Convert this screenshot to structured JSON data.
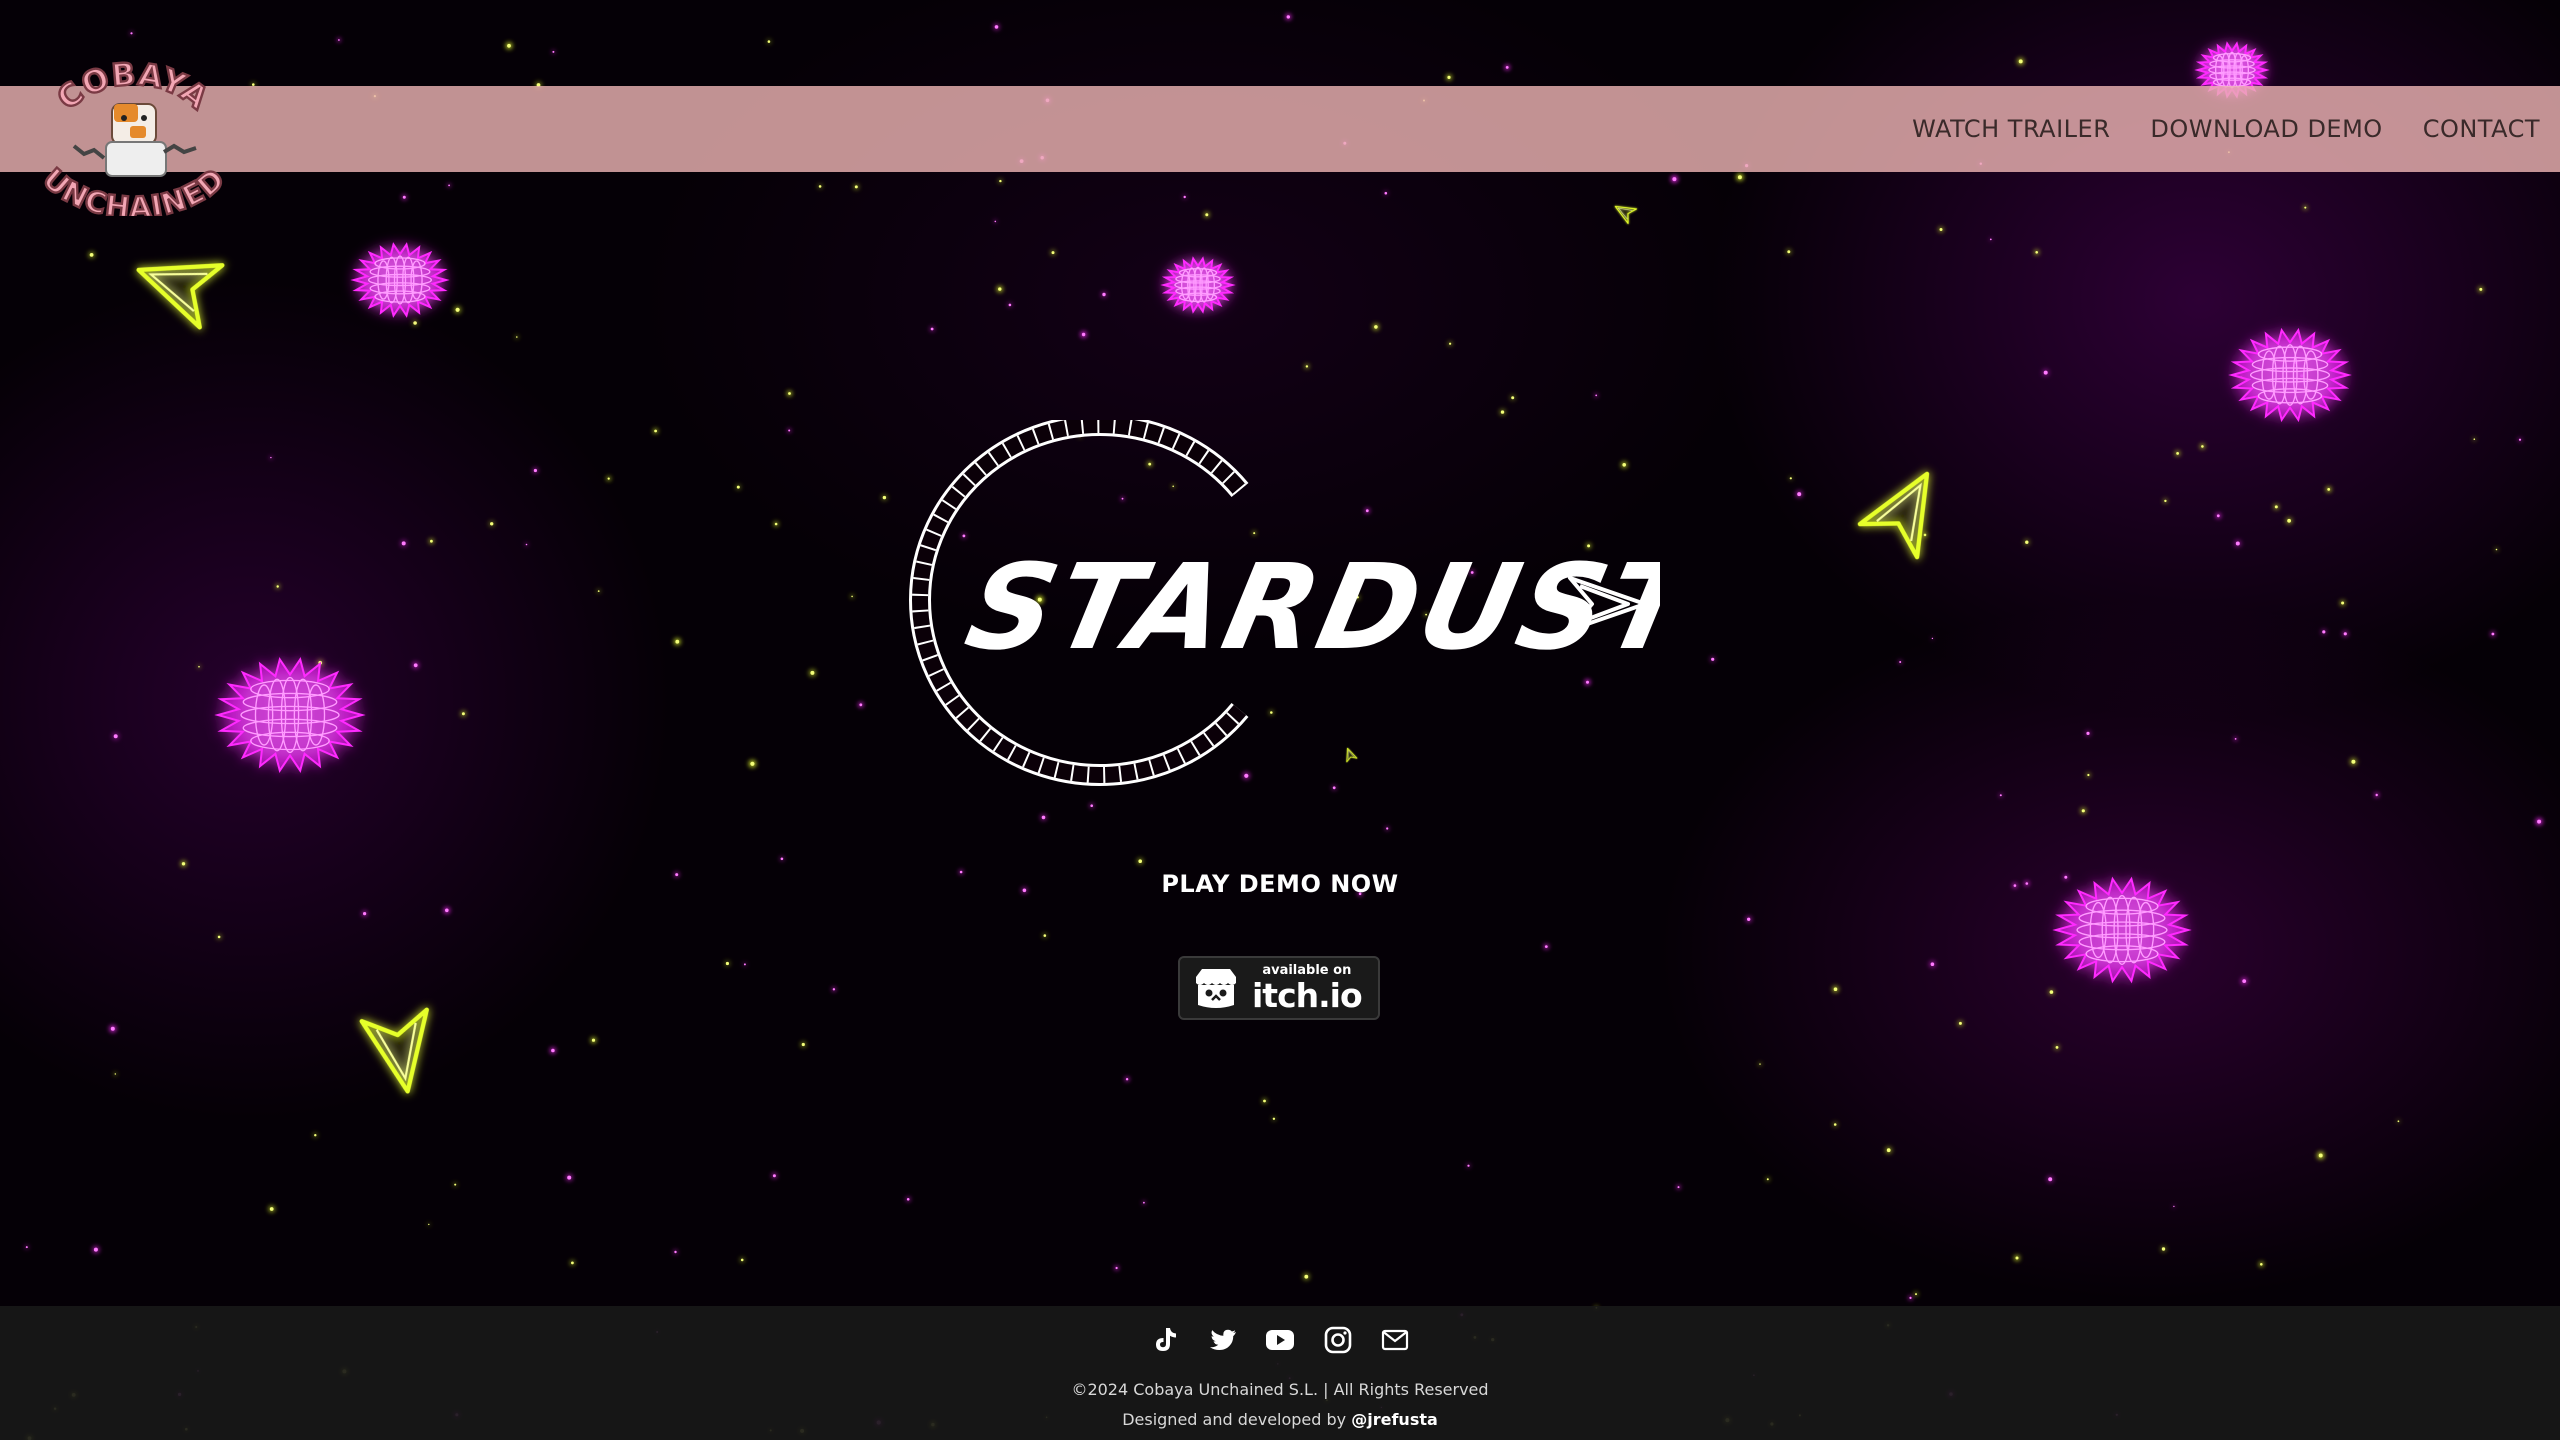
{
  "brand": {
    "logo_text_top": "COBAYA",
    "logo_text_bottom": "UNCHAINED",
    "logo_icon": "guinea-pig-mascot"
  },
  "nav": {
    "items": [
      {
        "label": "WATCH TRAILER"
      },
      {
        "label": "DOWNLOAD DEMO"
      },
      {
        "label": "CONTACT"
      }
    ]
  },
  "hero": {
    "game_title": "STARDUSTER",
    "cta_label": "PLAY DEMO NOW",
    "badge": {
      "small_text": "available on",
      "big_text": "itch.io",
      "icon": "itch-io-icon"
    }
  },
  "footer": {
    "social_icons": [
      "tiktok-icon",
      "twitter-icon",
      "youtube-icon",
      "instagram-icon",
      "mail-icon"
    ],
    "copyright": "©2024 Cobaya Unchained S.L. | All Rights Reserved",
    "credits_prefix": "Designed and developed by",
    "credits_handle": "@jrefusta"
  },
  "colors": {
    "header_bar": "#ecb2b2",
    "nav_text": "#3a2a2a",
    "magenta_glow": "#ff2bff",
    "yellow_glow": "#e6ff2a",
    "background": "#050006",
    "footer_bg": "#181818"
  }
}
